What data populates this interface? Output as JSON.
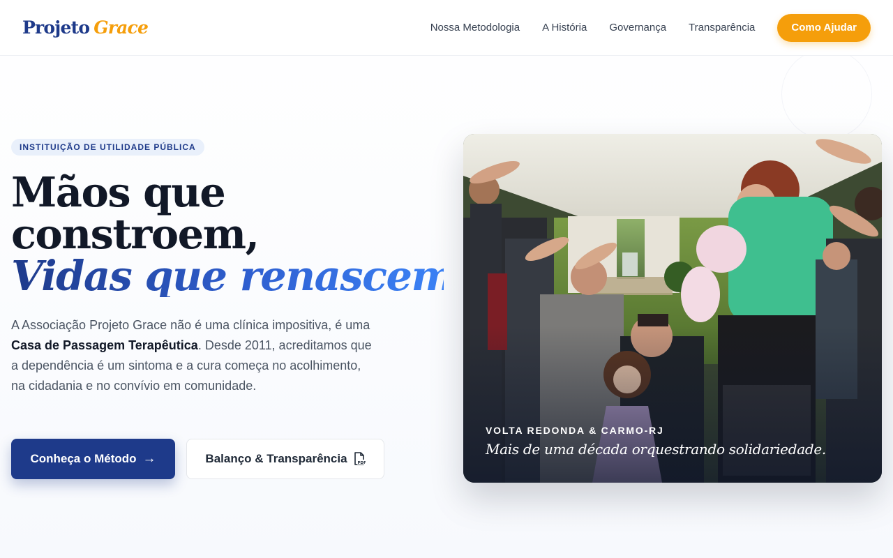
{
  "brand": {
    "name_main": "Projeto",
    "name_accent": "Grace",
    "primary_color": "#1e3a8a",
    "accent_color": "#f59e0b"
  },
  "nav": {
    "items": [
      {
        "label": "Nossa Metodologia"
      },
      {
        "label": "A História"
      },
      {
        "label": "Governança"
      },
      {
        "label": "Transparência"
      }
    ],
    "cta_label": "Como Ajudar"
  },
  "hero": {
    "badge": "INSTITUIÇÃO DE UTILIDADE PÚBLICA",
    "headline_line1": "Mãos que",
    "headline_line2": "constroem,",
    "headline_line3": "Vidas que renascem.",
    "description_part1": "A Associação Projeto Grace não é uma clínica impositiva, é uma ",
    "description_bold": "Casa de Passagem Terapêutica",
    "description_part2": ". Desde 2011, acreditamos que a dependência é um sintoma e a cura começa no acolhimento, na cidadania e no convívio em comunidade.",
    "primary_button": {
      "label": "Conheça o Método",
      "icon": "arrow-right-icon"
    },
    "secondary_button": {
      "label": "Balanço & Transparência",
      "icon": "pdf-file-icon"
    }
  },
  "photo": {
    "kicker": "VOLTA REDONDA & CARMO-RJ",
    "caption": "Mais de uma década orquestrando solidariedade."
  }
}
